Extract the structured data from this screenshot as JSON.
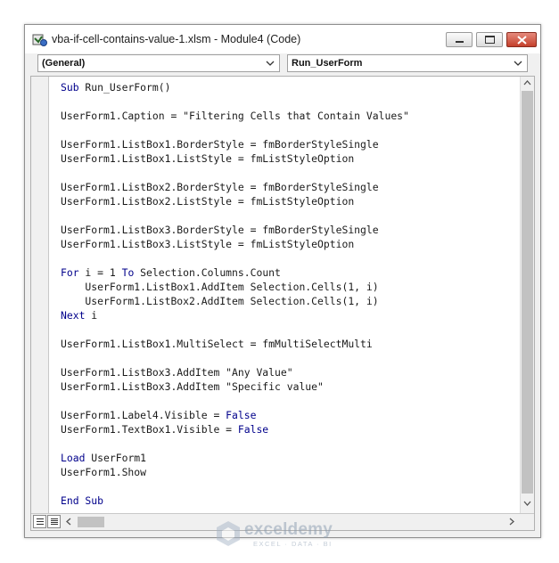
{
  "window": {
    "title": "vba-if-cell-contains-value-1.xlsm - Module4 (Code)",
    "icons": {
      "app": "vba-editor-icon",
      "minimize": "minimize-icon",
      "maximize": "maximize-icon",
      "close": "close-icon"
    },
    "accent_close": "#c4402b"
  },
  "toolbar": {
    "object_combo": "(General)",
    "procedure_combo": "Run_UserForm"
  },
  "code": {
    "keyword_color": "#00008b",
    "lines": [
      [
        {
          "t": "Sub",
          "k": true
        },
        {
          "t": " Run_UserForm()"
        }
      ],
      [],
      [
        {
          "t": "UserForm1.Caption = \"Filtering Cells that Contain Values\""
        }
      ],
      [],
      [
        {
          "t": "UserForm1.ListBox1.BorderStyle = fmBorderStyleSingle"
        }
      ],
      [
        {
          "t": "UserForm1.ListBox1.ListStyle = fmListStyleOption"
        }
      ],
      [],
      [
        {
          "t": "UserForm1.ListBox2.BorderStyle = fmBorderStyleSingle"
        }
      ],
      [
        {
          "t": "UserForm1.ListBox2.ListStyle = fmListStyleOption"
        }
      ],
      [],
      [
        {
          "t": "UserForm1.ListBox3.BorderStyle = fmBorderStyleSingle"
        }
      ],
      [
        {
          "t": "UserForm1.ListBox3.ListStyle = fmListStyleOption"
        }
      ],
      [],
      [
        {
          "t": "For",
          "k": true
        },
        {
          "t": " i = 1 "
        },
        {
          "t": "To",
          "k": true
        },
        {
          "t": " Selection.Columns.Count"
        }
      ],
      [
        {
          "t": "    UserForm1.ListBox1.AddItem Selection.Cells(1, i)"
        }
      ],
      [
        {
          "t": "    UserForm1.ListBox2.AddItem Selection.Cells(1, i)"
        }
      ],
      [
        {
          "t": "Next",
          "k": true
        },
        {
          "t": " i"
        }
      ],
      [],
      [
        {
          "t": "UserForm1.ListBox1.MultiSelect = fmMultiSelectMulti"
        }
      ],
      [],
      [
        {
          "t": "UserForm1.ListBox3.AddItem \"Any Value\""
        }
      ],
      [
        {
          "t": "UserForm1.ListBox3.AddItem \"Specific value\""
        }
      ],
      [],
      [
        {
          "t": "UserForm1.Label4.Visible = "
        },
        {
          "t": "False",
          "k": true
        }
      ],
      [
        {
          "t": "UserForm1.TextBox1.Visible = "
        },
        {
          "t": "False",
          "k": true
        }
      ],
      [],
      [
        {
          "t": "Load",
          "k": true
        },
        {
          "t": " UserForm1"
        }
      ],
      [
        {
          "t": "UserForm1.Show"
        }
      ],
      [],
      [
        {
          "t": "End Sub",
          "k": true
        }
      ]
    ]
  },
  "watermark": {
    "name": "exceldemy",
    "tagline": "EXCEL · DATA · BI",
    "icon": "exceldemy-logo-icon"
  }
}
